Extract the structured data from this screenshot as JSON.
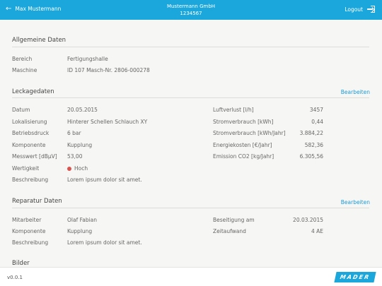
{
  "header": {
    "back_label": "Max Mustermann",
    "company": "Mustermann GmbH",
    "number": "1234567",
    "logout_label": "Logout"
  },
  "allgemein": {
    "title": "Allgemeine Daten",
    "rows": [
      {
        "label": "Bereich",
        "value": "Fertigungshalle"
      },
      {
        "label": "Maschine",
        "value": "ID 107 Masch-Nr. 2806-000278"
      }
    ]
  },
  "leckage": {
    "title": "Leckagedaten",
    "edit_label": "Bearbeiten",
    "left": [
      {
        "label": "Datum",
        "value": "20.05.2015"
      },
      {
        "label": "Lokalisierung",
        "value": "Hinterer Schellen Schlauch XY"
      },
      {
        "label": "Betriebsdruck",
        "value": "6 bar"
      },
      {
        "label": "Komponente",
        "value": "Kupplung"
      },
      {
        "label": "Messwert [dBμV]",
        "value": "53,00"
      },
      {
        "label": "Wertigkeit",
        "value": "Hoch",
        "status_color": "#d9534f"
      },
      {
        "label": "Beschreibung",
        "value": "Lorem ipsum dolor sit amet."
      }
    ],
    "right": [
      {
        "label": "Luftverlust [l/h]",
        "value": "3457"
      },
      {
        "label": "Stromverbrauch [kWh]",
        "value": "0,44"
      },
      {
        "label": "Stromverbrauch [kWh/Jahr]",
        "value": "3.884,22"
      },
      {
        "label": "Energiekosten [€/Jahr]",
        "value": "582,36"
      },
      {
        "label": "Emission CO2 [kg/Jahr]",
        "value": "6.305,56"
      }
    ]
  },
  "reparatur": {
    "title": "Reparatur Daten",
    "edit_label": "Bearbeiten",
    "left": [
      {
        "label": "Mitarbeiter",
        "value": "Olaf Fabian"
      },
      {
        "label": "Komponente",
        "value": "Kupplung"
      },
      {
        "label": "Beschreibung",
        "value": "Lorem ipsum dolor sit amet."
      }
    ],
    "right": [
      {
        "label": "Beseitigung am",
        "value": "20.03.2015"
      },
      {
        "label": "Zeitaufwand",
        "value": "4 AE"
      }
    ]
  },
  "bilder": {
    "title": "Bilder"
  },
  "footer": {
    "version": "v0.0.1",
    "logo_text": "MADER"
  },
  "colors": {
    "accent": "#1ba7dc",
    "status_high": "#d9534f"
  }
}
